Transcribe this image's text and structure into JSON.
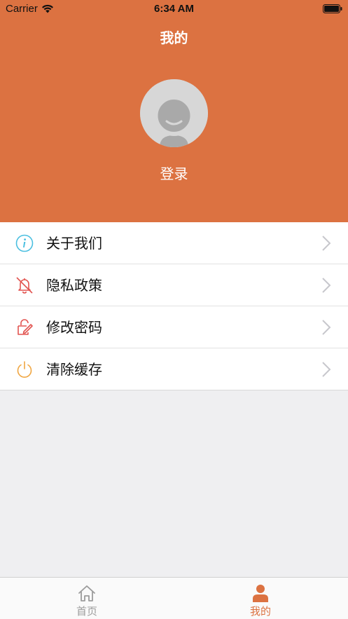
{
  "status_bar": {
    "carrier": "Carrier",
    "time": "6:34 AM"
  },
  "header": {
    "title": "我的",
    "login_label": "登录",
    "background_color": "#dc7241"
  },
  "menu": {
    "items": [
      {
        "label": "关于我们",
        "icon": "info-icon",
        "icon_color": "#4bbfe0"
      },
      {
        "label": "隐私政策",
        "icon": "bell-off-icon",
        "icon_color": "#e25450"
      },
      {
        "label": "修改密码",
        "icon": "edit-password-icon",
        "icon_color": "#e25450"
      },
      {
        "label": "清除缓存",
        "icon": "power-icon",
        "icon_color": "#f0a642"
      }
    ]
  },
  "tabbar": {
    "tabs": [
      {
        "label": "首页",
        "icon": "home-icon",
        "selected": false
      },
      {
        "label": "我的",
        "icon": "person-icon",
        "selected": true
      }
    ],
    "accent_color": "#dc7241",
    "inactive_color": "#9c9c9c"
  }
}
